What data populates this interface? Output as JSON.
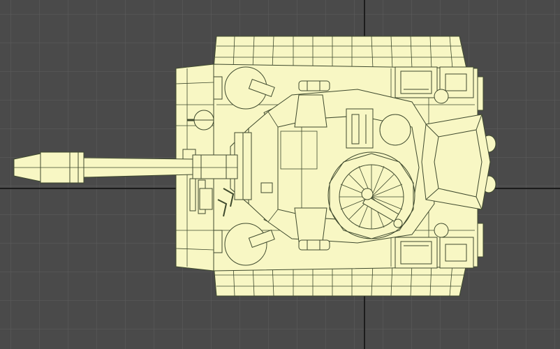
{
  "viewport": {
    "view": "Top",
    "shading": "Wireframe",
    "colors": {
      "background": "#4a4a4a",
      "grid": "#5e5e5e",
      "axis": "#1c1c1c",
      "model_fill": "#f8f7c4",
      "model_stroke": "#3f4a2e"
    }
  },
  "model": {
    "name": "tank",
    "parts": [
      "hull",
      "turret",
      "main-gun",
      "cupola",
      "tracks",
      "stowage-boxes",
      "hatches",
      "exhaust-louvers"
    ]
  }
}
